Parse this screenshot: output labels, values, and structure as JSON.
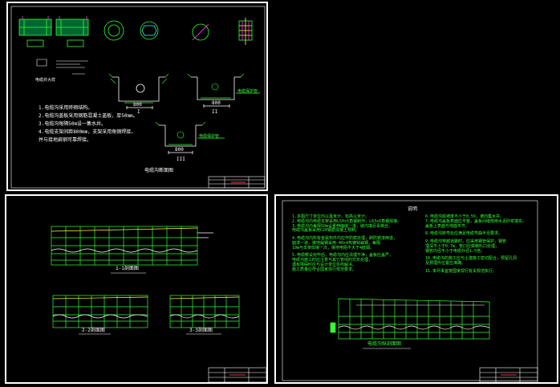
{
  "sheet1": {
    "section_labels": [
      "I",
      "II",
      "III"
    ],
    "dim_800": "800",
    "pipe_label": "电缆保护管",
    "bottom_caption": "电缆沟断面图",
    "notes": [
      "1.电缆沟采用砖砌结构。",
      "2.电缆沟盖板采用钢筋混凝土盖板，厚50mm。",
      "3.电缆沟每隔50m设一集水井。",
      "4.电缆支架间距800mm，支架采用角钢焊接，",
      "  并与接地扁钢可靠焊接。"
    ],
    "small_caption": "电缆井大样"
  },
  "sheet2": {
    "elev1_caption": "1-1剖面图",
    "elev2_caption": "2-2剖面图",
    "elev3_caption": "3-3剖面图"
  },
  "sheet3": {
    "notes_title": "说明",
    "notes_left": [
      "1.本图尺寸单位均以毫米计，标高以米计。",
      "2.电缆沟内电缆支架采用L50x5角钢制作，L63x6角钢焊接。",
      "3.电缆沟内每隔50m设置伸缩缝一道，缝内填沥青麻丝。",
      "  电缆沟盖板采用C20钢筋混凝土预制。",
      "4.电缆沟内所有金属构件均应作防腐处理，刷防锈漆两道，",
      "  面漆一道，接地扁钢采用-40x4热镀锌扁钢，每隔",
      "  10m与支架焊接一次，接地电阻不大于4欧姆。",
      "5.电缆敷设完毕后，电缆沟内应清理干净，盖板应盖严，",
      "  电缆沟施工时应注意与其它管线的交叉处理，",
      "  遇有障碍时应与设计单位协商解决。",
      "  施工质量应符合国家现行规范要求。"
    ],
    "notes_right": [
      "6.电缆沟底坡度不小于0.5%，坡向集水井。",
      "7.电缆沟盖板表面应平整，盖板间缝隙用水泥砂浆填实。",
      "  盖板上表面与地面平齐。",
      "8.电缆沟转弯处应满足电缆弯曲半径要求。",
      "9.电缆沟穿越道路时，应采用钢管保护，钢管",
      "  埋深不小于0.7m，管口应做喇叭口处理，",
      "  钢管内径不小于电缆外径1.5倍。",
      "10.电缆沟的施工应与土建施工密切配合，预留孔洞",
      "   及预埋件位置应准确。",
      "11.未尽事宜按国家现行有关规范执行。"
    ],
    "elev_caption": "电缆沟纵剖面图"
  },
  "colors": {
    "line": "#33ff33",
    "frame": "#ffffff",
    "accent": "#ff3333",
    "cyan": "#33ffff",
    "bg": "#000000"
  }
}
